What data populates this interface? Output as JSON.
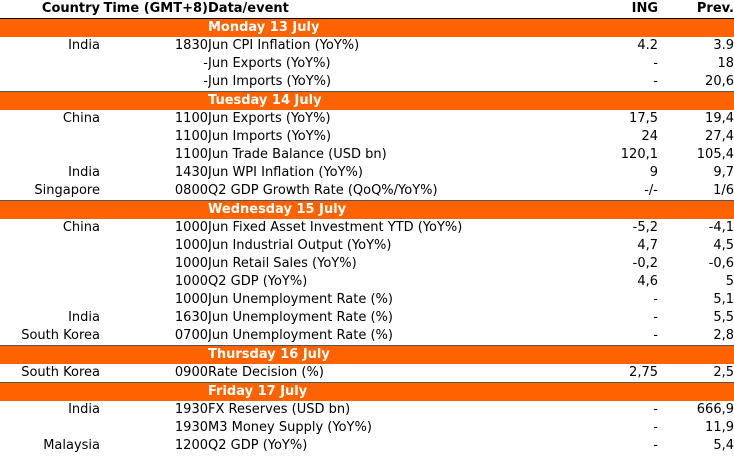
{
  "header": {
    "country": "Country",
    "time": "Time (GMT+8)",
    "event": "Data/event",
    "ing": "ING",
    "prev": "Prev."
  },
  "accent_color": "#ff6200",
  "days": [
    {
      "label": "Monday 13 July",
      "rows": [
        {
          "country": "India",
          "time": "1830",
          "event": "Jun CPI Inflation (YoY%)",
          "ing": "4.2",
          "prev": "3.9"
        },
        {
          "country": "",
          "time": "-",
          "event": "Jun Exports (YoY%)",
          "ing": "-",
          "prev": "18"
        },
        {
          "country": "",
          "time": "-",
          "event": "Jun Imports (YoY%)",
          "ing": "-",
          "prev": "20,6"
        }
      ]
    },
    {
      "label": "Tuesday 14 July",
      "rows": [
        {
          "country": "China",
          "time": "1100",
          "event": "Jun Exports (YoY%)",
          "ing": "17,5",
          "prev": "19,4"
        },
        {
          "country": "",
          "time": "1100",
          "event": "Jun Imports (YoY%)",
          "ing": "24",
          "prev": "27,4"
        },
        {
          "country": "",
          "time": "1100",
          "event": "Jun Trade Balance (USD bn)",
          "ing": "120,1",
          "prev": "105,4"
        },
        {
          "country": "India",
          "time": "1430",
          "event": "Jun WPI Inflation (YoY%)",
          "ing": "9",
          "prev": "9,7"
        },
        {
          "country": "Singapore",
          "time": "0800",
          "event": "Q2 GDP Growth Rate (QoQ%/YoY%)",
          "ing": "-/-",
          "prev": "1/6"
        }
      ]
    },
    {
      "label": "Wednesday 15 July",
      "rows": [
        {
          "country": "China",
          "time": "1000",
          "event": "Jun Fixed Asset Investment YTD (YoY%)",
          "ing": "-5,2",
          "prev": "-4,1"
        },
        {
          "country": "",
          "time": "1000",
          "event": "Jun Industrial Output (YoY%)",
          "ing": "4,7",
          "prev": "4,5"
        },
        {
          "country": "",
          "time": "1000",
          "event": "Jun Retail Sales (YoY%)",
          "ing": "-0,2",
          "prev": "-0,6"
        },
        {
          "country": "",
          "time": "1000",
          "event": "Q2 GDP (YoY%)",
          "ing": "4,6",
          "prev": "5"
        },
        {
          "country": "",
          "time": "1000",
          "event": "Jun Unemployment Rate (%)",
          "ing": "-",
          "prev": "5,1"
        },
        {
          "country": "India",
          "time": "1630",
          "event": "Jun Unemployment Rate (%)",
          "ing": "-",
          "prev": "5,5"
        },
        {
          "country": "South Korea",
          "time": "0700",
          "event": "Jun Unemployment Rate (%)",
          "ing": "-",
          "prev": "2,8"
        }
      ]
    },
    {
      "label": "Thursday 16 July",
      "rows": [
        {
          "country": "South Korea",
          "time": "0900",
          "event": "Rate Decision (%)",
          "ing": "2,75",
          "prev": "2,5"
        }
      ]
    },
    {
      "label": "Friday 17 July",
      "rows": [
        {
          "country": "India",
          "time": "1930",
          "event": "FX Reserves (USD bn)",
          "ing": "-",
          "prev": "666,9"
        },
        {
          "country": "",
          "time": "1930",
          "event": "M3 Money Supply (YoY%)",
          "ing": "-",
          "prev": "11,9"
        },
        {
          "country": "Malaysia",
          "time": "1200",
          "event": "Q2 GDP (YoY%)",
          "ing": "-",
          "prev": "5,4"
        }
      ]
    }
  ]
}
